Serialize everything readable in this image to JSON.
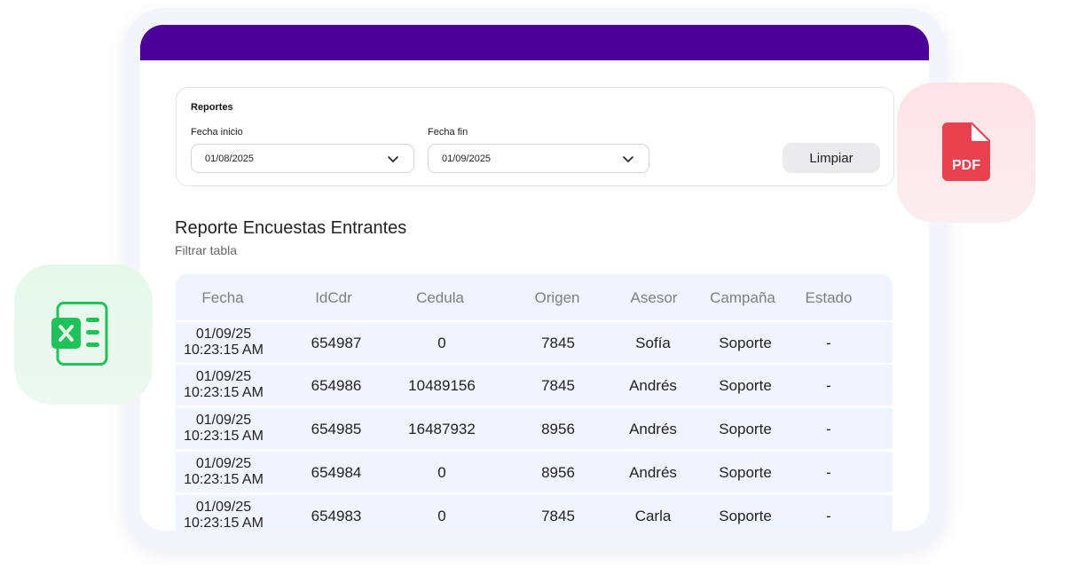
{
  "colors": {
    "topbar": "#4b0097",
    "pdf_red": "#e8414f",
    "excel_green": "#1fc25a"
  },
  "filters": {
    "title": "Reportes",
    "start_label": "Fecha inicio",
    "start_value": "01/08/2025",
    "end_label": "Fecha fin",
    "end_value": "01/09/2025",
    "clear_button": "Limpiar"
  },
  "report": {
    "title": "Reporte Encuestas Entrantes",
    "filter_link": "Filtrar tabla"
  },
  "table": {
    "headers": [
      "Fecha",
      "IdCdr",
      "Cedula",
      "Origen",
      "Asesor",
      "Campaña",
      "Estado"
    ],
    "rows": [
      {
        "date": "01/09/25",
        "time": "10:23:15 AM",
        "idcdr": "654987",
        "cedula": "0",
        "origen": "7845",
        "asesor": "Sofía",
        "campana": "Soporte",
        "estado": "-"
      },
      {
        "date": "01/09/25",
        "time": "10:23:15 AM",
        "idcdr": "654986",
        "cedula": "10489156",
        "origen": "7845",
        "asesor": "Andrés",
        "campana": "Soporte",
        "estado": "-"
      },
      {
        "date": "01/09/25",
        "time": "10:23:15 AM",
        "idcdr": "654985",
        "cedula": "16487932",
        "origen": "8956",
        "asesor": "Andrés",
        "campana": "Soporte",
        "estado": "-"
      },
      {
        "date": "01/09/25",
        "time": "10:23:15 AM",
        "idcdr": "654984",
        "cedula": "0",
        "origen": "8956",
        "asesor": "Andrés",
        "campana": "Soporte",
        "estado": "-"
      },
      {
        "date": "01/09/25",
        "time": "10:23:15 AM",
        "idcdr": "654983",
        "cedula": "0",
        "origen": "7845",
        "asesor": "Carla",
        "campana": "Soporte",
        "estado": "-"
      }
    ]
  },
  "export": {
    "pdf_icon": "pdf-file-icon",
    "pdf_label": "PDF",
    "excel_icon": "excel-file-icon"
  }
}
